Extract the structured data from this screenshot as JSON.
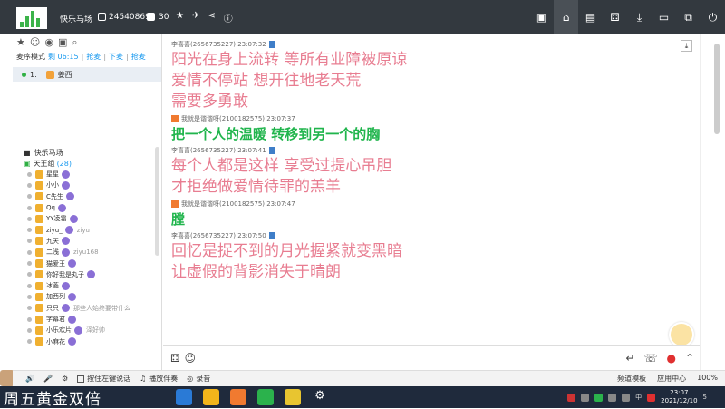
{
  "titlebar": {
    "room_name": "快乐马场",
    "room_id": "24540869",
    "user_count": "30",
    "icons": [
      "★",
      "✈",
      "⋖",
      "ⓘ"
    ],
    "right_icons": [
      "▣",
      "⌂",
      "▤",
      "⚃",
      "⤓",
      "▭",
      "⧉",
      "⏻"
    ]
  },
  "left": {
    "icons": [
      "★",
      "☺",
      "◉",
      "▣",
      "⌕"
    ],
    "mode_label": "麦序模式",
    "mode_time": "剩 06:15",
    "mode_links": [
      "抢麦",
      "下麦",
      "抢麦"
    ],
    "queue": {
      "num": "1.",
      "name": "姜西"
    },
    "tree_title": "快乐马场",
    "channel": "天王组",
    "channel_count": "(28)",
    "members": [
      {
        "name": "星星",
        "extra": ""
      },
      {
        "name": "小小",
        "extra": ""
      },
      {
        "name": "C先生",
        "extra": ""
      },
      {
        "name": "Qq",
        "extra": ""
      },
      {
        "name": "YY凌霜",
        "extra": ""
      },
      {
        "name": "ziyu_",
        "extra": "ziyu"
      },
      {
        "name": "九天",
        "extra": ""
      },
      {
        "name": "二浅",
        "extra": "ziyu168"
      },
      {
        "name": "猫爱王",
        "extra": ""
      },
      {
        "name": "你好我是丸子",
        "extra": ""
      },
      {
        "name": "冰菱",
        "extra": ""
      },
      {
        "name": "加西列",
        "extra": ""
      },
      {
        "name": "只只",
        "extra": "那些人始终要带什么"
      },
      {
        "name": "字幕君",
        "extra": ""
      },
      {
        "name": "小乐欢片",
        "extra": "泽好帅"
      },
      {
        "name": "小麻花",
        "extra": ""
      }
    ]
  },
  "chat": {
    "messages": [
      {
        "meta": "李喜喜(2656735227)  23:07:32",
        "style": "pink",
        "lines": [
          "阳光在身上流转 等所有业障被原谅",
          "爱情不停站 想开往地老天荒",
          "需要多勇敢"
        ]
      },
      {
        "meta": "我就是谐谐呀(2100182575)  23:07:37",
        "style": "green",
        "lines": [
          "把一个人的温暖 转移到另一个的胸"
        ]
      },
      {
        "meta": "李喜喜(2656735227)  23:07:41",
        "style": "pink",
        "lines": [
          "每个人都是这样 享受过提心吊胆",
          "才拒绝做爱情待罪的羔羊"
        ]
      },
      {
        "meta": "我就是谐谐呀(2100182575)  23:07:47",
        "style": "green",
        "lines": [
          "膛"
        ]
      },
      {
        "meta": "李喜喜(2656735227)  23:07:50",
        "style": "pink",
        "lines": [
          "回忆是捉不到的月光握紧就变黑暗",
          "让虚假的背影消失于晴朗"
        ]
      }
    ]
  },
  "bottom": {
    "items": [
      "按住左键说话",
      "播放伴奏",
      "录音"
    ],
    "right_items": [
      "频道模板",
      "应用中心",
      "100%"
    ]
  },
  "taskbar": {
    "search_text": "周五黄金双倍",
    "time": "23:07",
    "date": "2021/12/10",
    "lang": "中",
    "notif": "5"
  }
}
